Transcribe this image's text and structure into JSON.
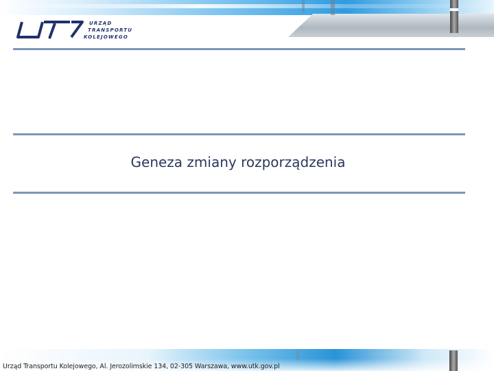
{
  "logo": {
    "line1": "URZĄD",
    "line2": "TRANSPORTU",
    "line3": "KOLEJOWEGO",
    "brand_color": "#22306a"
  },
  "slide": {
    "title": "Geneza zmiany rozporządzenia"
  },
  "footer": {
    "text": "Urząd Transportu Kolejowego, Al. Jerozolimskie 134, 02-305 Warszawa, www.utk.gov.pl"
  },
  "colors": {
    "rule": "#7d95b9",
    "title": "#2a3a5c",
    "banner_accent": "#2f9be0"
  }
}
